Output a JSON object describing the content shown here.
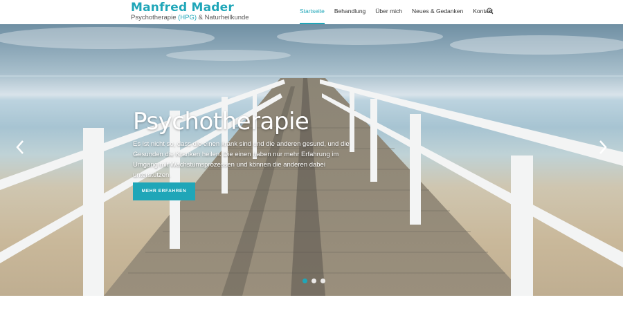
{
  "header": {
    "logo_title": "Manfred Mader",
    "logo_sub_pre": "Psychotherapie ",
    "logo_sub_hpg": "(HPG)",
    "logo_sub_post": " & Naturheilkunde",
    "nav": [
      {
        "label": "Startseite",
        "active": true
      },
      {
        "label": "Behandlung",
        "active": false
      },
      {
        "label": "Über mich",
        "active": false
      },
      {
        "label": "Neues & Gedanken",
        "active": false
      },
      {
        "label": "Kontakt",
        "active": false
      }
    ],
    "search_icon": "search-icon"
  },
  "hero": {
    "title": "Psychotherapie",
    "text": "Es ist nicht so, dass die einen krank sind und die anderen gesund, und die Gesunden die Kranken heilen. Die einen haben nur mehr Erfahrung im Umgang mit Wachstumsprozessen und können die anderen dabei unterstützen.",
    "button_label": "MEHR ERFAHREN",
    "prev_icon": "chevron-left-icon",
    "next_icon": "chevron-right-icon",
    "slide_count": 3,
    "active_slide": 1
  },
  "colors": {
    "accent": "#1fa6b8",
    "text_dark": "#333333"
  }
}
